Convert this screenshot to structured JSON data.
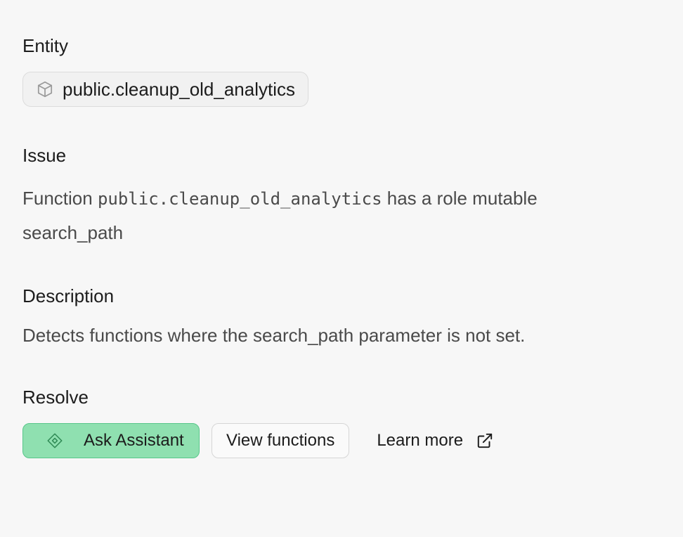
{
  "entity": {
    "title": "Entity",
    "chip_icon": "cube-icon",
    "chip_label": "public.cleanup_old_analytics"
  },
  "issue": {
    "title": "Issue",
    "text_before": "Function ",
    "code": "public.cleanup_old_analytics",
    "text_after": " has a role mutable search_path"
  },
  "description": {
    "title": "Description",
    "text": "Detects functions where the search_path parameter is not set."
  },
  "resolve": {
    "title": "Resolve",
    "ask_assistant_label": "Ask Assistant",
    "ask_assistant_icon": "assistant-diamond-icon",
    "view_functions_label": "View functions",
    "learn_more_label": "Learn more",
    "learn_more_icon": "external-link-icon"
  },
  "colors": {
    "background": "#f7f7f7",
    "primary_button": "#8fe0b0",
    "primary_border": "#58c68a",
    "text": "#1c1c1c",
    "muted_text": "#4a4a4a"
  }
}
